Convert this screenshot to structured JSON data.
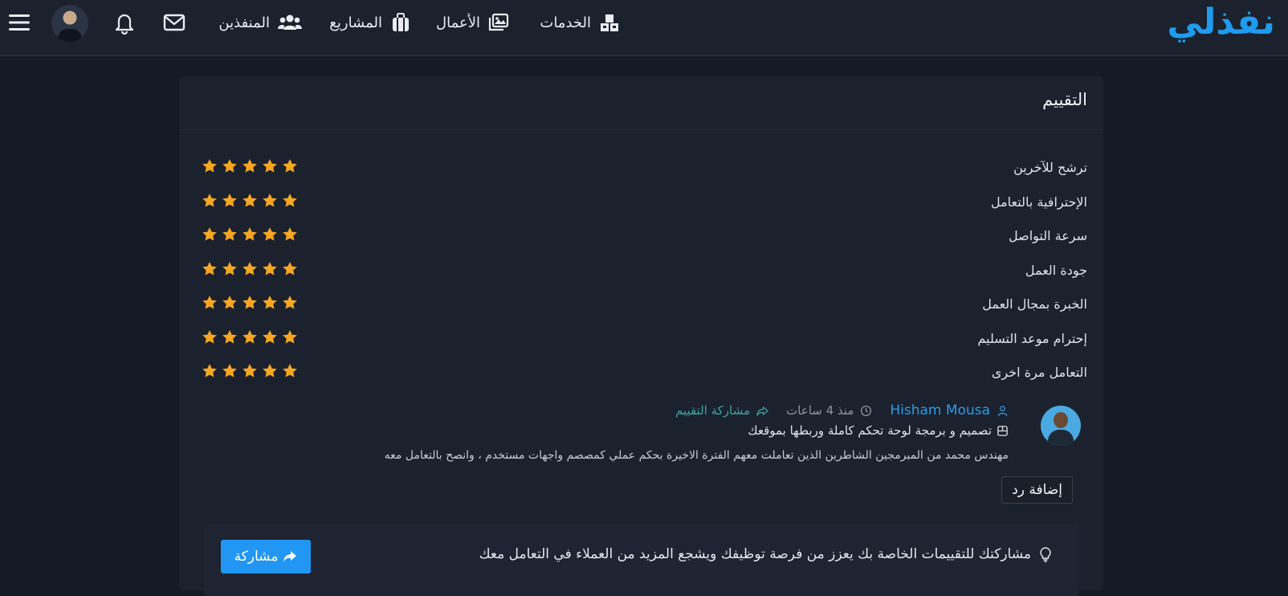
{
  "header": {
    "logo": "نفذلي",
    "nav": [
      {
        "label": "الخدمات",
        "icon": "boxes-icon"
      },
      {
        "label": "الأعمال",
        "icon": "images-icon"
      },
      {
        "label": "المشاريع",
        "icon": "suitcase-icon"
      },
      {
        "label": "المنفذين",
        "icon": "users-icon"
      }
    ]
  },
  "card": {
    "title": "التقييم",
    "ratings": [
      {
        "label": "ترشح للآخرين",
        "stars": 5
      },
      {
        "label": "الإحترافية بالتعامل",
        "stars": 5
      },
      {
        "label": "سرعة التواصل",
        "stars": 5
      },
      {
        "label": "جودة العمل",
        "stars": 5
      },
      {
        "label": "الخبرة بمجال العمل",
        "stars": 5
      },
      {
        "label": "إحترام موعد التسليم",
        "stars": 5
      },
      {
        "label": "التعامل مرة اخرى",
        "stars": 5
      }
    ],
    "review": {
      "name": "Hisham Mousa",
      "time": "منذ 4 ساعات",
      "share_label": "مشاركة التقييم",
      "project": "تصميم و برمجة لوحة تحكم كاملة وربطها بموقعك",
      "comment": "مهندس محمد من المبرمجين الشاطرين الذين تعاملت معهم الفترة الاخيرة بحكم عملي كمصصم واجهات مستخدم ، وانصح بالتعامل معه",
      "reply_label": "إضافة رد"
    },
    "footer": {
      "tip": "مشاركتك للتقييمات الخاصة بك يعزز من فرصة توظيفك ويشجع المزيد من العملاء في التعامل معك",
      "share_button": "مشاركة"
    }
  },
  "colors": {
    "accent": "#2196f3",
    "star": "#f5a623",
    "background": "#141a26",
    "card": "#1b212d"
  }
}
